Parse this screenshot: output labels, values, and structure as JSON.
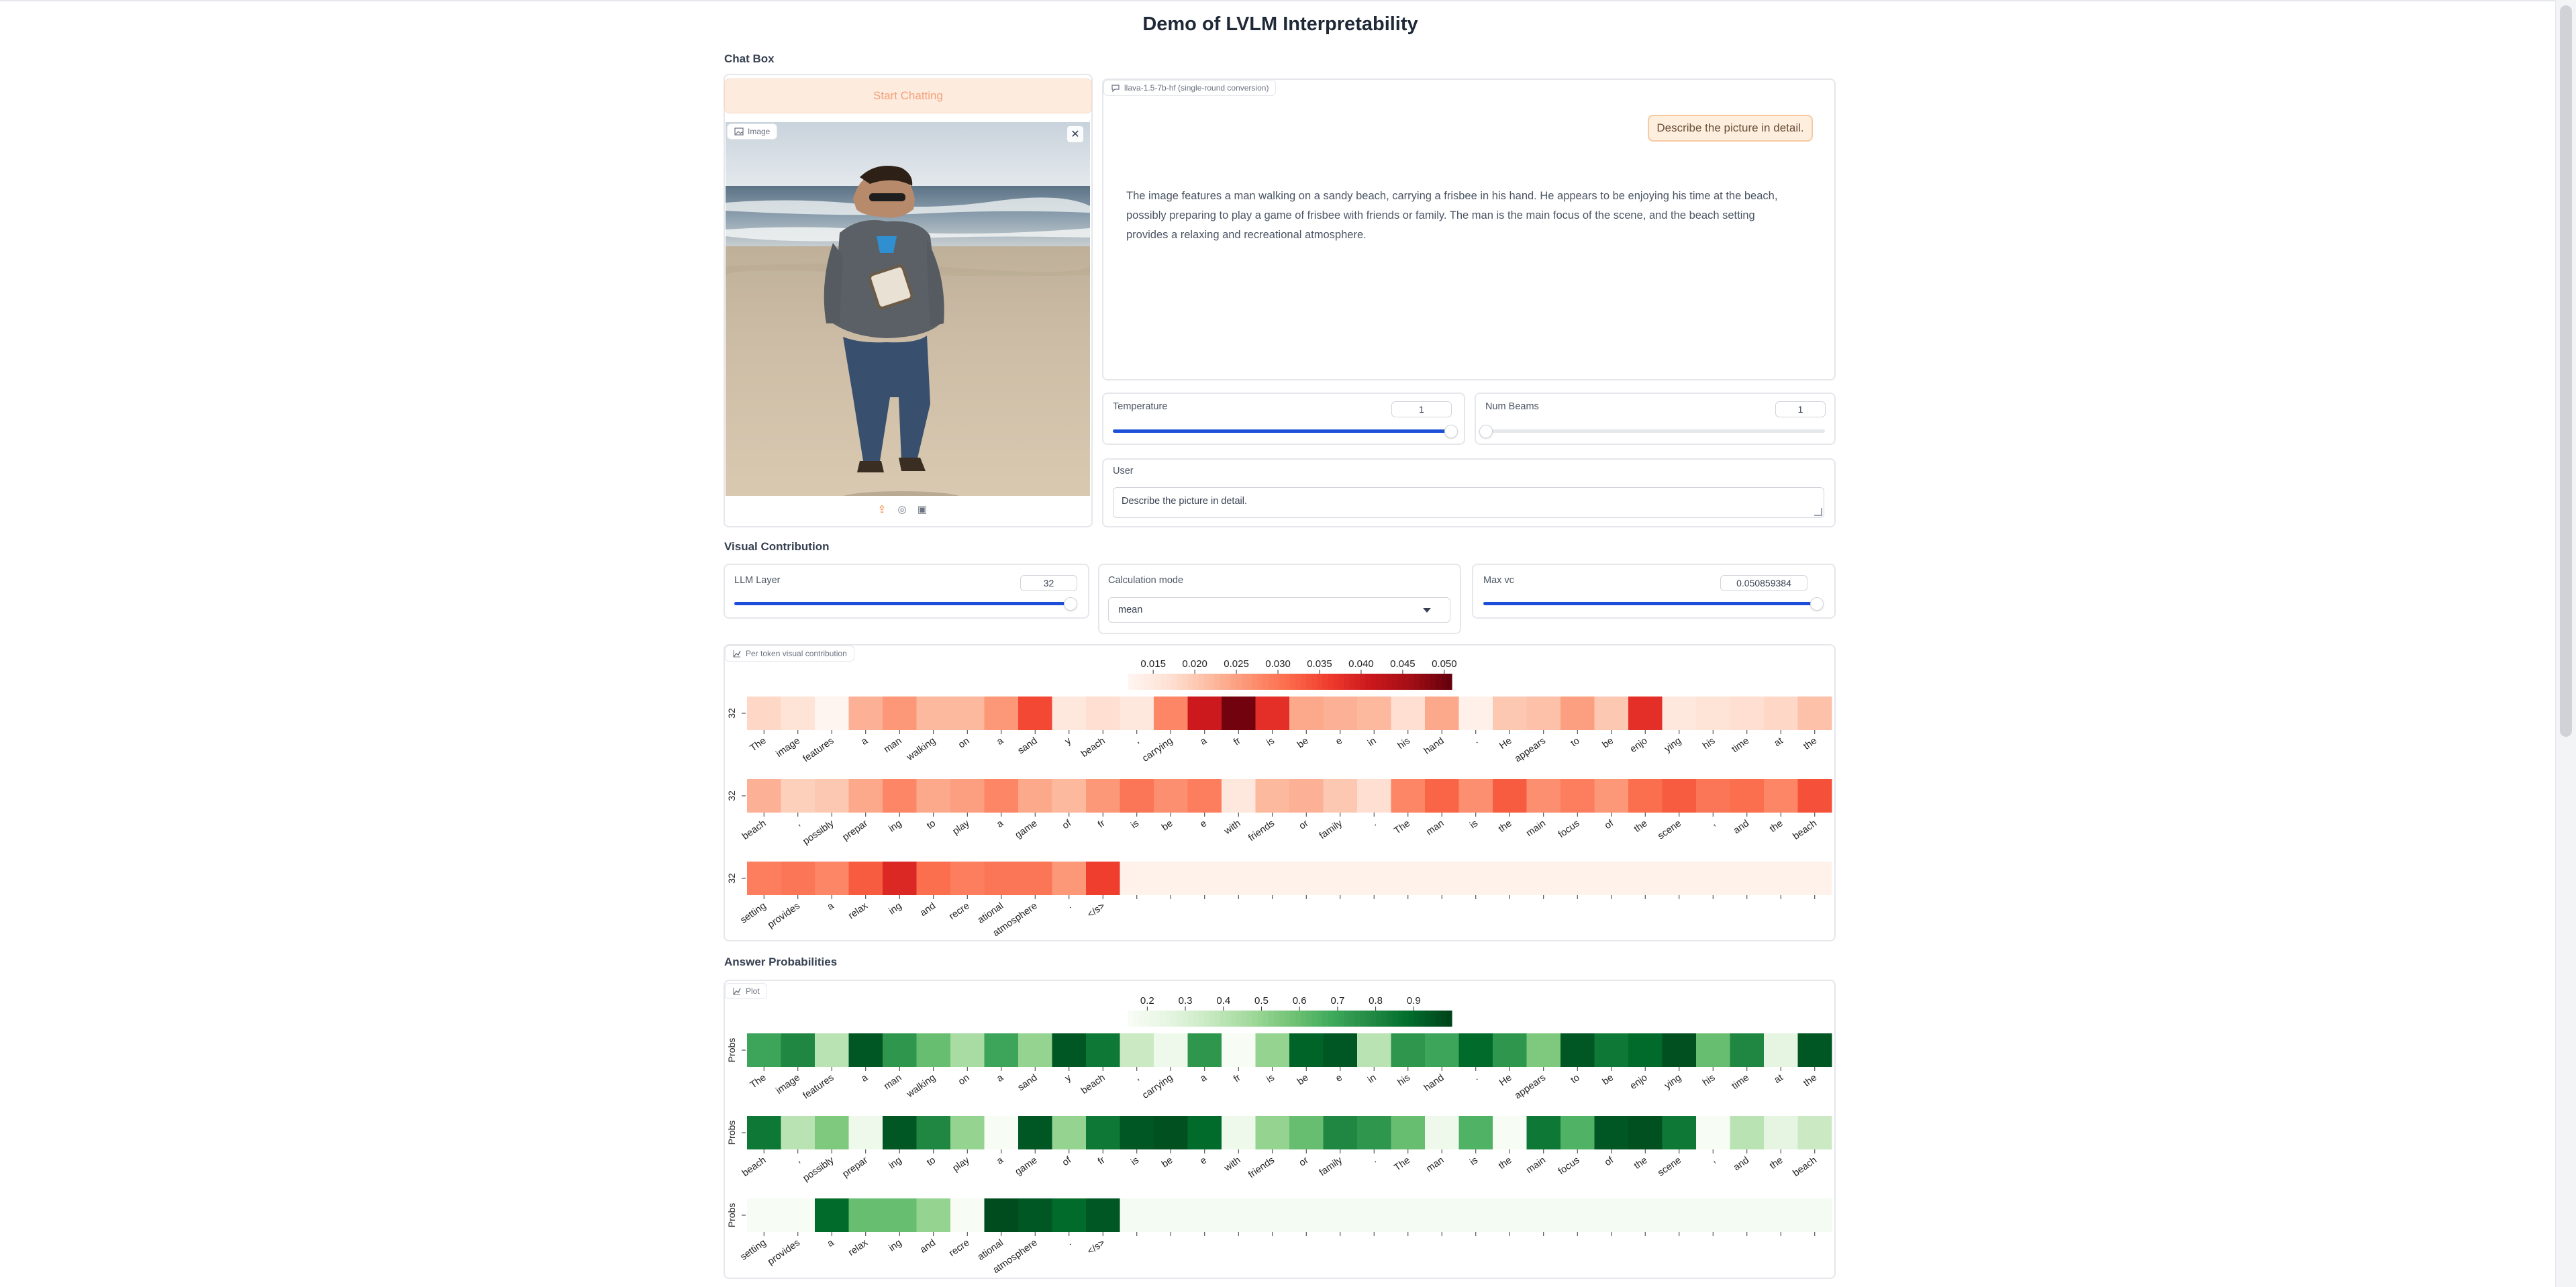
{
  "app": {
    "title": "Demo of LVLM Interpretability"
  },
  "chat_box": {
    "section_title": "Chat Box",
    "start_button": "Start Chatting",
    "image_label": "Image",
    "chatbot_label": "llava-1.5-7b-hf (single-round conversion)",
    "user_message": "Describe the picture in detail.",
    "assistant_message": "The image features a man walking on a sandy beach, carrying a frisbee in his hand. He appears to be enjoying his time at the beach, possibly preparing to play a game of frisbee with friends or family. The man is the main focus of the scene, and the beach setting provides a relaxing and recreational atmosphere.",
    "temperature": {
      "label": "Temperature",
      "value": "1",
      "fraction": 0.99
    },
    "num_beams": {
      "label": "Num Beams",
      "value": "1",
      "fraction": 0.0
    },
    "user": {
      "label": "User",
      "value": "Describe the picture in detail."
    }
  },
  "visual_contribution": {
    "section_title": "Visual Contribution",
    "llm_layer": {
      "label": "LLM Layer",
      "value": "32",
      "fraction": 1.0
    },
    "calculation_mode": {
      "label": "Calculation mode",
      "value": "mean"
    },
    "max_vc": {
      "label": "Max vc",
      "value": "0.050859384",
      "fraction": 1.0
    },
    "plot_label": "Per token visual contribution"
  },
  "answer_probabilities": {
    "section_title": "Answer Probabilities",
    "plot_label": "Plot"
  },
  "chart_data": [
    {
      "type": "heatmap",
      "name": "Per token visual contribution",
      "colorscale": "Reds",
      "colorbar_ticks": [
        "0.015",
        "0.020",
        "0.025",
        "0.030",
        "0.035",
        "0.040",
        "0.045",
        "0.050"
      ],
      "vmin": 0.012,
      "vmax": 0.0509,
      "row_label": "32",
      "rows": [
        {
          "tokens": [
            "The",
            "image",
            "features",
            "a",
            "man",
            "walking",
            "on",
            "a",
            "sand",
            "y",
            "beach",
            ",",
            "carrying",
            "a",
            "fr",
            "is",
            "be",
            "e",
            "in",
            "his",
            "hand",
            ".",
            "He",
            "appears",
            "to",
            "be",
            "enjo",
            "ying",
            "his",
            "time",
            "at",
            "the"
          ],
          "values": [
            0.018,
            0.016,
            0.012,
            0.023,
            0.026,
            0.022,
            0.022,
            0.026,
            0.035,
            0.015,
            0.017,
            0.015,
            0.028,
            0.041,
            0.05,
            0.038,
            0.024,
            0.023,
            0.022,
            0.017,
            0.024,
            0.013,
            0.02,
            0.021,
            0.025,
            0.02,
            0.038,
            0.015,
            0.016,
            0.017,
            0.018,
            0.021
          ]
        },
        {
          "tokens": [
            "beach",
            ",",
            "possibly",
            "prepar",
            "ing",
            "to",
            "play",
            "a",
            "game",
            "of",
            "fr",
            "is",
            "be",
            "e",
            "with",
            "friends",
            "or",
            "family",
            ".",
            "The",
            "man",
            "is",
            "the",
            "main",
            "focus",
            "of",
            "the",
            "scene",
            ",",
            "and",
            "the",
            "beach"
          ],
          "values": [
            0.023,
            0.019,
            0.02,
            0.024,
            0.028,
            0.024,
            0.025,
            0.028,
            0.024,
            0.022,
            0.026,
            0.03,
            0.027,
            0.029,
            0.015,
            0.022,
            0.023,
            0.02,
            0.017,
            0.028,
            0.032,
            0.027,
            0.033,
            0.027,
            0.029,
            0.026,
            0.031,
            0.033,
            0.03,
            0.031,
            0.028,
            0.034
          ]
        },
        {
          "tokens": [
            "setting",
            "provides",
            "a",
            "relax",
            "ing",
            "and",
            "recre",
            "ational",
            "atmosphere",
            ".",
            "</s>"
          ],
          "values": [
            0.029,
            0.03,
            0.028,
            0.033,
            0.039,
            0.031,
            0.029,
            0.03,
            0.03,
            0.026,
            0.036
          ]
        }
      ]
    },
    {
      "type": "heatmap",
      "name": "Plot",
      "colorscale": "Greens",
      "colorbar_ticks": [
        "0.2",
        "0.3",
        "0.4",
        "0.5",
        "0.6",
        "0.7",
        "0.8",
        "0.9"
      ],
      "vmin": 0.15,
      "vmax": 1.0,
      "row_label": "Probs",
      "rows": [
        {
          "tokens": [
            "The",
            "image",
            "features",
            "a",
            "man",
            "walking",
            "on",
            "a",
            "sand",
            "y",
            "beach",
            ",",
            "carrying",
            "a",
            "fr",
            "is",
            "be",
            "e",
            "in",
            "his",
            "hand",
            ".",
            "He",
            "appears",
            "to",
            "be",
            "enjo",
            "ying",
            "his",
            "time",
            "at",
            "the"
          ],
          "values": [
            0.7,
            0.8,
            0.4,
            0.95,
            0.75,
            0.6,
            0.45,
            0.7,
            0.5,
            0.95,
            0.85,
            0.35,
            0.2,
            0.75,
            0.05,
            0.5,
            0.92,
            0.95,
            0.4,
            0.75,
            0.7,
            0.9,
            0.75,
            0.55,
            0.95,
            0.85,
            0.9,
            0.97,
            0.6,
            0.8,
            0.25,
            0.95
          ]
        },
        {
          "tokens": [
            "beach",
            ",",
            "possibly",
            "prepar",
            "ing",
            "to",
            "play",
            "a",
            "game",
            "of",
            "fr",
            "is",
            "be",
            "e",
            "with",
            "friends",
            "or",
            "family",
            ".",
            "The",
            "man",
            "is",
            "the",
            "main",
            "focus",
            "of",
            "the",
            "scene",
            ",",
            "and",
            "the",
            "beach"
          ],
          "values": [
            0.85,
            0.4,
            0.55,
            0.2,
            0.95,
            0.8,
            0.5,
            0.15,
            0.95,
            0.5,
            0.85,
            0.95,
            0.97,
            0.9,
            0.2,
            0.5,
            0.6,
            0.8,
            0.75,
            0.6,
            0.2,
            0.65,
            0.15,
            0.85,
            0.65,
            0.95,
            0.97,
            0.85,
            0.1,
            0.4,
            0.25,
            0.35
          ]
        },
        {
          "tokens": [
            "setting",
            "provides",
            "a",
            "relax",
            "ing",
            "and",
            "recre",
            "ational",
            "atmosphere",
            ".",
            "</s>"
          ],
          "values": [
            0.12,
            0.05,
            0.9,
            0.6,
            0.6,
            0.5,
            0.05,
            0.98,
            0.95,
            0.9,
            0.95
          ]
        }
      ]
    }
  ]
}
